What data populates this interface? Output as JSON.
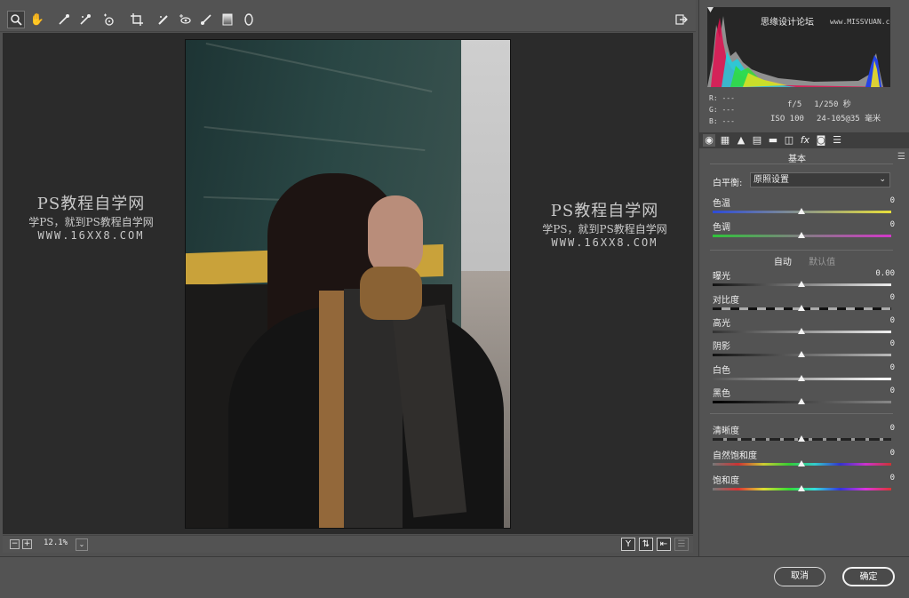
{
  "toolbar": {
    "tools": [
      {
        "name": "zoom-tool",
        "icon": "magnifier-icon",
        "active": true
      },
      {
        "name": "hand-tool",
        "icon": "hand-icon"
      },
      {
        "name": "white-balance-tool",
        "icon": "eyedropper-icon"
      },
      {
        "name": "color-sampler-tool",
        "icon": "color-sampler-icon"
      },
      {
        "name": "targeted-adjustment-tool",
        "icon": "target-adjust-icon"
      },
      {
        "name": "crop-tool",
        "icon": "crop-icon"
      },
      {
        "name": "spot-removal-tool",
        "icon": "spot-removal-icon"
      },
      {
        "name": "red-eye-tool",
        "icon": "red-eye-icon"
      },
      {
        "name": "adjustment-brush-tool",
        "icon": "brush-icon"
      },
      {
        "name": "graduated-filter-tool",
        "icon": "gradient-icon"
      },
      {
        "name": "radial-filter-tool",
        "icon": "radial-icon"
      }
    ],
    "open_button_icon": "open-export-icon"
  },
  "watermark": {
    "title": "PS教程自学网",
    "subtitle": "学PS，就到PS教程自学网",
    "url": "WWW.16XX8.COM"
  },
  "bottombar": {
    "zoom_minus": "−",
    "zoom_plus": "+",
    "zoom_value": "12.1%",
    "zoom_dropdown": "⌄",
    "view_buttons": [
      "Y",
      "⇅",
      "⇤",
      "☰"
    ]
  },
  "histogram": {
    "tag": "思缘设计论坛",
    "tag_url": "www.MISSVUAN.com"
  },
  "readout": {
    "r": "R:  ---",
    "g": "G:  ---",
    "b": "B:  ---",
    "aperture": "f/5",
    "shutter": "1/250 秒",
    "iso": "ISO 100",
    "lens": "24-105@35 毫米"
  },
  "tabs": [
    "basic-icon",
    "tone-curve-icon",
    "detail-icon",
    "hsl-icon",
    "split-toning-icon",
    "lens-icon",
    "effects-icon",
    "camera-calibration-icon",
    "presets-icon"
  ],
  "basic": {
    "section_title": "基本",
    "white_balance_label": "白平衡:",
    "white_balance_value": "原照设置",
    "temp_label": "色温",
    "temp_value": "0",
    "tint_label": "色调",
    "tint_value": "0",
    "auto_label": "自动",
    "default_label": "默认值",
    "sliders": [
      {
        "label": "曝光",
        "value": "0.00",
        "position": 0.5
      },
      {
        "label": "对比度",
        "value": "0",
        "position": 0.5
      },
      {
        "label": "高光",
        "value": "0",
        "position": 0.5
      },
      {
        "label": "阴影",
        "value": "0",
        "position": 0.5
      },
      {
        "label": "白色",
        "value": "0",
        "position": 0.5
      },
      {
        "label": "黑色",
        "value": "0",
        "position": 0.5
      }
    ],
    "presence": [
      {
        "label": "清晰度",
        "value": "0",
        "position": 0.5
      },
      {
        "label": "自然饱和度",
        "value": "0",
        "position": 0.5
      },
      {
        "label": "饱和度",
        "value": "0",
        "position": 0.5
      }
    ]
  },
  "footer": {
    "cancel_label": "取消",
    "ok_label": "确定"
  }
}
